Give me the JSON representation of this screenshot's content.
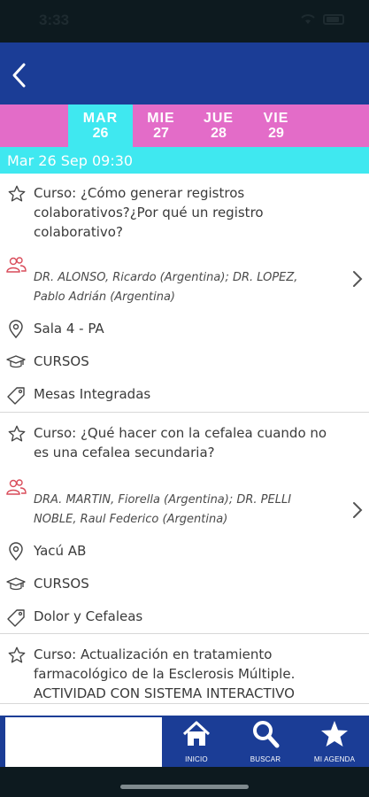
{
  "status_bar": {
    "time": "3:33"
  },
  "header": {
    "back_icon": "chevron-left-icon"
  },
  "date_tabs": [
    {
      "day": "MAR",
      "date": "26",
      "active": true
    },
    {
      "day": "MIE",
      "date": "27",
      "active": false
    },
    {
      "day": "JUE",
      "date": "28",
      "active": false
    },
    {
      "day": "VIE",
      "date": "29",
      "active": false
    }
  ],
  "section": {
    "label": "Mar 26 Sep 09:30"
  },
  "events": [
    {
      "title": "Curso: ¿Cómo generar registros colaborativos?¿Por qué un registro colaborativo?",
      "speakers": "DR. ALONSO, Ricardo (Argentina); DR. LOPEZ, Pablo Adrián (Argentina)",
      "room": "Sala 4 - PA",
      "type": "CURSOS",
      "tag": "Mesas Integradas"
    },
    {
      "title": "Curso: ¿Qué hacer con la cefalea cuando no es una cefalea secundaria?",
      "speakers": "DRA. MARTIN, Fiorella (Argentina); DR. PELLI NOBLE, Raul Federico (Argentina)",
      "room": "Yacú AB",
      "type": "CURSOS",
      "tag": "Dolor y Cefaleas"
    },
    {
      "title": "Curso: Actualización en tratamiento farmacológico de la Esclerosis Múltiple. ACTIVIDAD CON SISTEMA INTERACTIVO"
    }
  ],
  "tabbar": {
    "items": [
      {
        "label": "INICIO",
        "icon": "home-icon"
      },
      {
        "label": "BUSCAR",
        "icon": "search-icon"
      },
      {
        "label": "MI AGENDA",
        "icon": "star-icon"
      }
    ]
  },
  "colors": {
    "header": "#1b3d96",
    "tabs": "#e36cc8",
    "accent": "#3fe8f0",
    "speaker_icon": "#d94c5a"
  }
}
